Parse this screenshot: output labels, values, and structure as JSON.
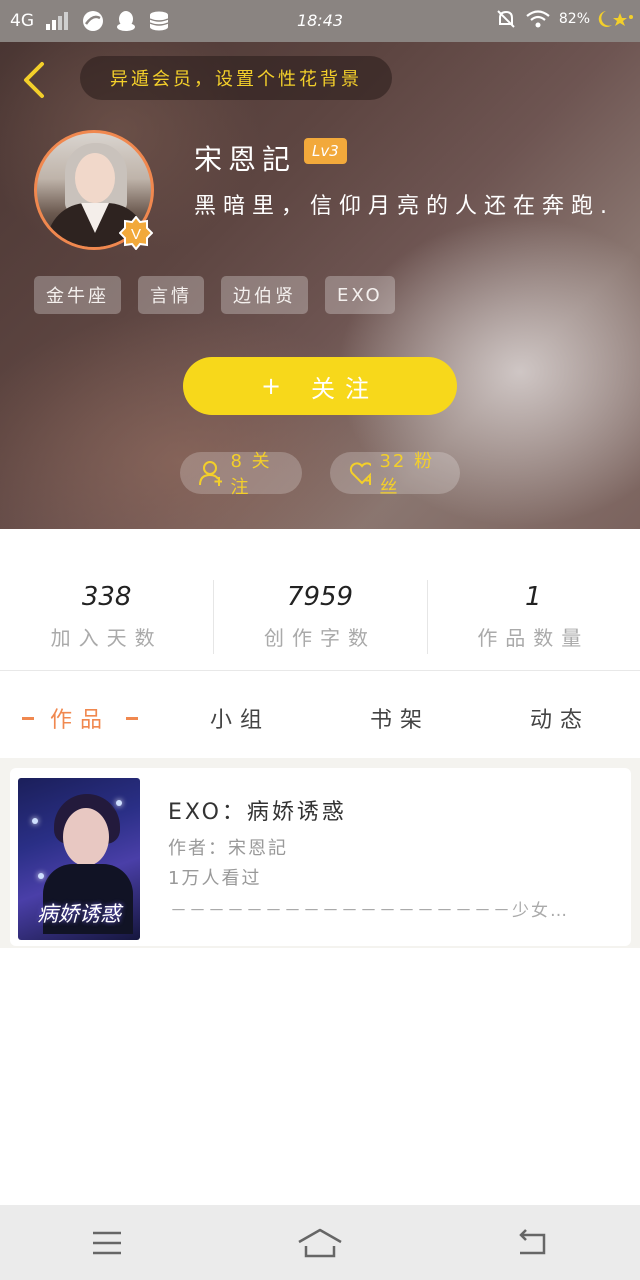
{
  "status_bar": {
    "network": "4G",
    "time": "18:43",
    "battery": "82%",
    "icons": [
      "signal-icon",
      "browser-icon",
      "qq-icon",
      "storage-icon",
      "mute-icon",
      "wifi-icon",
      "battery-icon"
    ]
  },
  "header": {
    "banner_text": "异遁会员，设置个性花背景",
    "username": "宋恩記",
    "level": "Lv3",
    "vip_mark": "V",
    "signature": "黑暗里，信仰月亮的人还在奔跑.",
    "tags": [
      "金牛座",
      "言情",
      "边伯贤",
      "EXO"
    ],
    "follow_label": "关注",
    "follow_plus": "+",
    "following_text": "8 关注",
    "fans_text": "32 粉丝"
  },
  "stats": [
    {
      "value": "338",
      "label": "加入天数"
    },
    {
      "value": "7959",
      "label": "创作字数"
    },
    {
      "value": "1",
      "label": "作品数量"
    }
  ],
  "tabs": [
    {
      "label": "作品",
      "active": true
    },
    {
      "label": "小组",
      "active": false
    },
    {
      "label": "书架",
      "active": false
    },
    {
      "label": "动态",
      "active": false
    }
  ],
  "book": {
    "title": "EXO：病娇诱惑",
    "author": "作者：宋恩記",
    "views": "1万人看过",
    "intro": "－－－－－－－－－－－－－－－－－－少女…",
    "cover_text": "病娇诱惑"
  },
  "colors": {
    "accent_orange": "#f0884f",
    "follow_yellow": "#f7d81b",
    "banner_gold": "#f3cf2a",
    "level_orange": "#f2a93b"
  }
}
